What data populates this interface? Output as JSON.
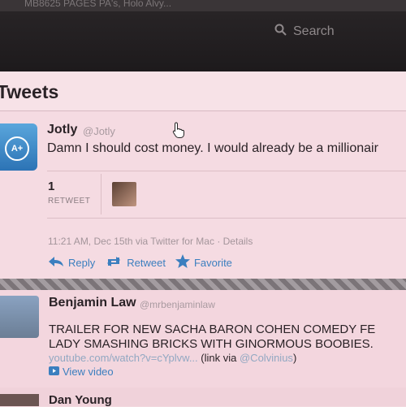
{
  "browser": {
    "tab_left": "MB8625 PAGES PA's, Holo Alvy...",
    "tab_right": "",
    "search_placeholder": "Search"
  },
  "timeline": {
    "title": "Tweets"
  },
  "tweets": [
    {
      "author": "Jotly",
      "handle": "@Jotly",
      "avatar_text": "A+",
      "text": "Damn I should cost money. I would already be a millionair",
      "retweet_count": "1",
      "retweet_label": "RETWEET",
      "timestamp": "11:21 AM, Dec 15th via Twitter for Mac · Details",
      "actions": {
        "reply": "Reply",
        "retweet": "Retweet",
        "favorite": "Favorite"
      }
    },
    {
      "author": "Benjamin Law",
      "handle": "@mrbenjaminlaw",
      "text_line1": "TRAILER FOR NEW SACHA BARON COHEN COMEDY FE",
      "text_line2": "LADY SMASHING BRICKS WITH GINORMOUS BOOBIES.",
      "link_url": "youtube.com/watch?v=cYplvw...",
      "link_via_prefix": "(link via ",
      "link_via_user": "@Colvinius",
      "link_via_suffix": ")",
      "video_label": "View video"
    },
    {
      "author": "Dan Young"
    }
  ],
  "colors": {
    "link": "#3b7fbf",
    "topbar": "#221f21",
    "accent_avatar": "#3a87c8"
  }
}
